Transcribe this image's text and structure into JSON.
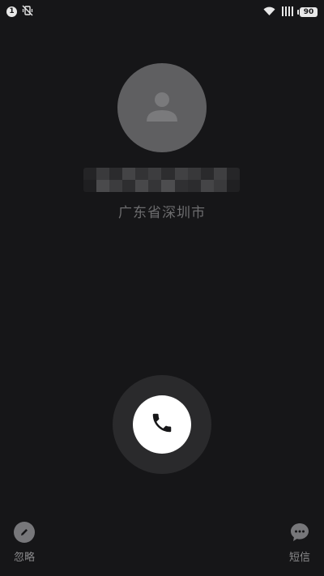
{
  "status_bar": {
    "notification_count": "1",
    "battery_level": "90"
  },
  "caller": {
    "location": "广东省深圳市"
  },
  "actions": {
    "ignore_label": "忽略",
    "sms_label": "短信"
  },
  "colors": {
    "background": "#161618",
    "avatar": "#5f5f61",
    "answer_ring": "#2a2a2c",
    "answer_button": "#ffffff"
  }
}
